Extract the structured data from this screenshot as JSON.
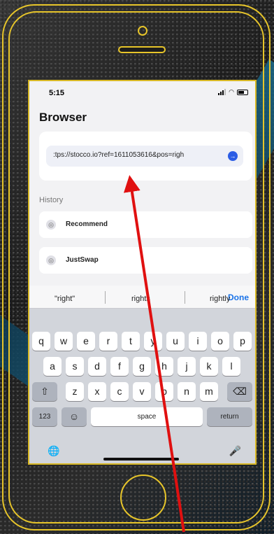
{
  "status": {
    "time": "5:15"
  },
  "browser": {
    "title": "Browser",
    "url_value": ":tps://stocco.io?ref=1611053616&pos=righ",
    "go_symbol": "→"
  },
  "history": {
    "label": "History",
    "items": [
      {
        "label": "Recommend",
        "icon": "globe-icon"
      },
      {
        "label": "JustSwap",
        "icon": "globe-icon"
      }
    ]
  },
  "keyboard": {
    "done": "Done",
    "suggestions": [
      "\"right\"",
      "rights",
      "rightly"
    ],
    "row1": [
      "q",
      "w",
      "e",
      "r",
      "t",
      "y",
      "u",
      "i",
      "o",
      "p"
    ],
    "row2": [
      "a",
      "s",
      "d",
      "f",
      "g",
      "h",
      "j",
      "k",
      "l"
    ],
    "row3": [
      "z",
      "x",
      "c",
      "v",
      "b",
      "n",
      "m"
    ],
    "shift": "⇧",
    "backspace": "⌫",
    "numbers": "123",
    "emoji": "☺",
    "space": "space",
    "return": "return",
    "globe": "🌐",
    "mic": "🎤"
  },
  "colors": {
    "accent": "#e7c52a",
    "arrow": "#e01010",
    "link": "#1a73e8"
  }
}
